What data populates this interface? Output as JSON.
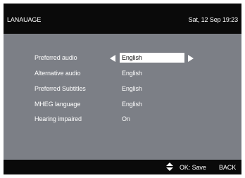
{
  "header": {
    "title": "LANAUAGE",
    "datetime": "Sat, 12 Sep 19:23"
  },
  "settings": [
    {
      "label": "Preferred audio",
      "value": "English"
    },
    {
      "label": "Alternative audio",
      "value": "English"
    },
    {
      "label": "Preferred Subtitles",
      "value": "English"
    },
    {
      "label": "MHEG language",
      "value": "English"
    },
    {
      "label": "Hearing impaired",
      "value": "On"
    }
  ],
  "footer": {
    "nav_icon": "up-down-icon",
    "ok_label": "OK: Save",
    "back_label": "BACK"
  },
  "colors": {
    "bars": "#0a0a0a",
    "panel": "#7c7f86",
    "selection": "#ffffff",
    "text": "#ffffff"
  }
}
